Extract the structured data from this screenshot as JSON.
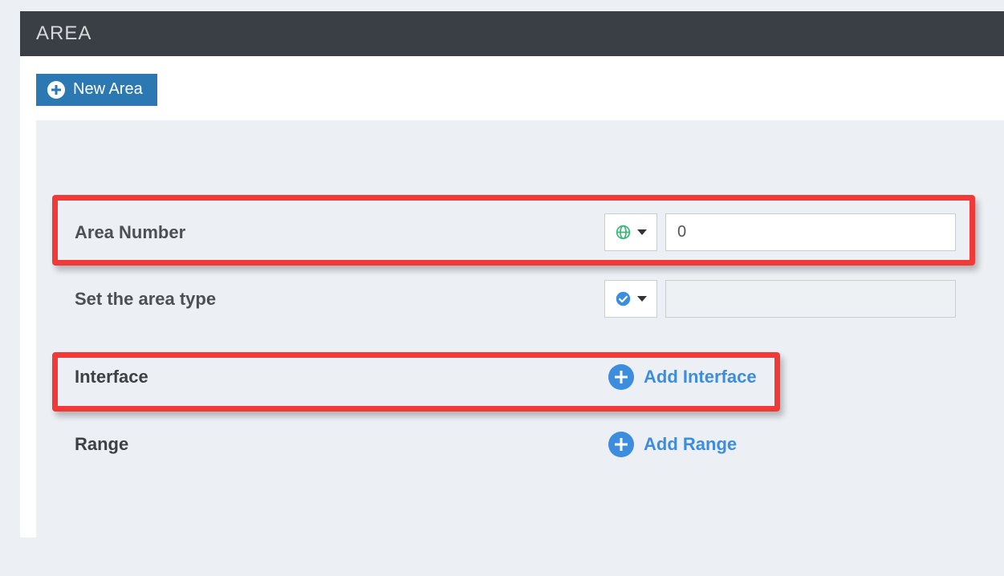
{
  "header": {
    "title": "AREA"
  },
  "toolbar": {
    "new_area_label": "New Area"
  },
  "form": {
    "area_number": {
      "label": "Area Number",
      "value": "0",
      "mode": "global"
    },
    "area_type": {
      "label": "Set the area type",
      "value": "",
      "mode": "enabled"
    },
    "interface": {
      "label": "Interface",
      "add_label": "Add Interface"
    },
    "range": {
      "label": "Range",
      "add_label": "Add Range"
    }
  },
  "colors": {
    "accent": "#2b78b3",
    "link": "#3c8dde",
    "highlight": "#f03a38",
    "header_bg": "#3a3f46",
    "page_bg": "#ecf0f5",
    "success": "#3cb878"
  }
}
